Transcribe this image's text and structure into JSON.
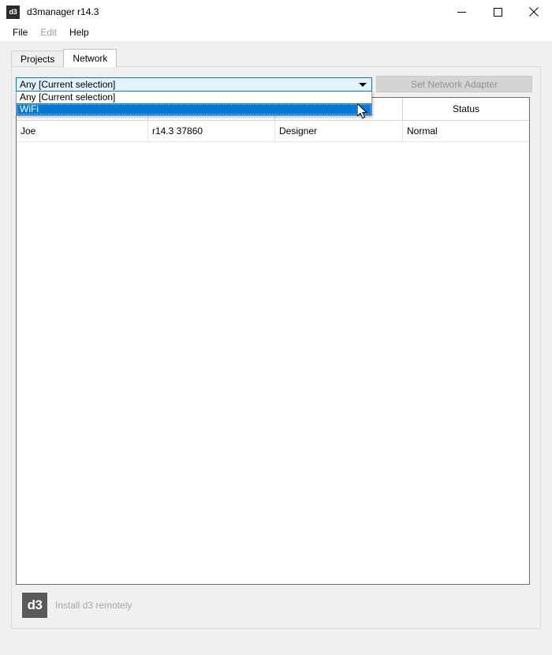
{
  "window": {
    "app_icon_text": "d3",
    "title": "d3manager  r14.3",
    "controls": {
      "minimize": "minimize-button",
      "maximize": "maximize-button",
      "close": "close-button"
    }
  },
  "menubar": {
    "items": [
      {
        "label": "File",
        "disabled": false
      },
      {
        "label": "Edit",
        "disabled": true
      },
      {
        "label": "Help",
        "disabled": false
      }
    ]
  },
  "tabs": [
    {
      "label": "Projects",
      "active": false
    },
    {
      "label": "Network",
      "active": true
    }
  ],
  "network_panel": {
    "adapter_combo": {
      "value": "Any [Current selection]",
      "expanded": true,
      "options": [
        {
          "label": "Any [Current selection]",
          "selected": false
        },
        {
          "label": "WiFi",
          "selected": true
        }
      ]
    },
    "set_adapter_button": {
      "label": "Set Network Adapter",
      "disabled": true
    },
    "table": {
      "columns": [
        "",
        "",
        "",
        "Status"
      ],
      "rows": [
        {
          "name": "Joe",
          "version": "r14.3 37860",
          "type": "Designer",
          "status": "Normal"
        }
      ]
    }
  },
  "footer": {
    "icon_text": "d3",
    "label": "Install d3 remotely"
  },
  "colors": {
    "accent": "#0078d7",
    "combo_bg": "#e5f1fb",
    "window_bg": "#f0f0f0",
    "disabled_text": "#909090"
  }
}
